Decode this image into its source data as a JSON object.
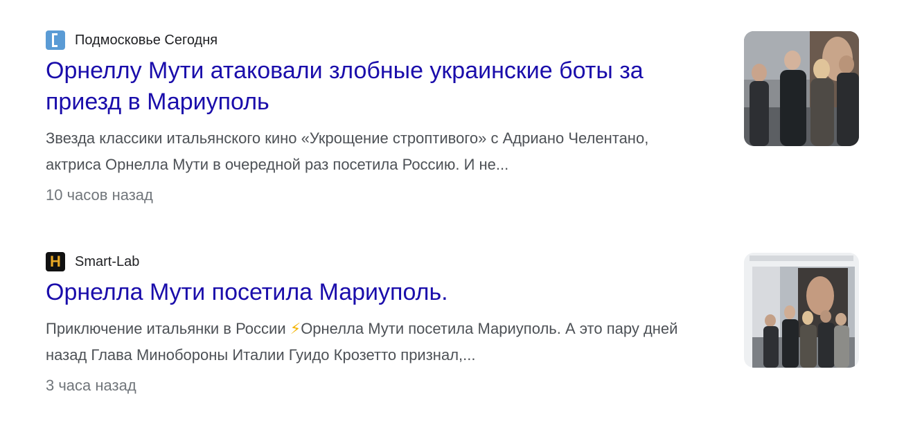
{
  "results": [
    {
      "source": "Подмосковье Сегодня",
      "favicon": "podmoskovye-favicon",
      "title": "Орнеллу Мути атаковали злобные украинские боты за приезд в Мариуполь",
      "snippet": "Звезда классики итальянского кино «Укрощение строптивого» с Адриано Челентано, актриса Орнелла Мути в очередной раз посетила Россию. И не...",
      "time": "10 часов назад"
    },
    {
      "source": "Smart-Lab",
      "favicon": "smartlab-favicon",
      "favicon_glyph": "H",
      "title": "Орнелла Мути посетила Мариуполь.",
      "snippet_before": "Приключение итальянки в России ",
      "snippet_icon": "⚡",
      "snippet_after": "Орнелла Мути посетила Мариуполь. А это пару дней назад Глава Минобороны Италии Гуидо Крозетто признал,...",
      "time": "3 часа назад"
    }
  ],
  "colors": {
    "title": "#1a0dab",
    "snippet": "#4d5156",
    "time": "#70757a",
    "source": "#202124"
  }
}
